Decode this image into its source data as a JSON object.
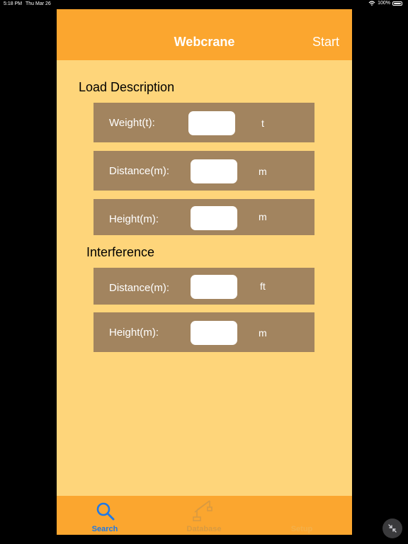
{
  "status_bar": {
    "time": "5:18 PM",
    "date": "Thu Mar 26",
    "battery": "100%"
  },
  "nav": {
    "title": "Webcrane",
    "start_label": "Start"
  },
  "load_description": {
    "title": "Load Description",
    "rows": [
      {
        "label": "Weight(t):",
        "value": "",
        "unit": "t"
      },
      {
        "label": "Distance(m):",
        "value": "",
        "unit": "m"
      },
      {
        "label": "Height(m):",
        "value": "",
        "unit": "m"
      }
    ]
  },
  "interference": {
    "title": "Interference",
    "rows": [
      {
        "label": "Distance(m):",
        "value": "",
        "unit": "ft"
      },
      {
        "label": "Height(m):",
        "value": "",
        "unit": "m"
      }
    ]
  },
  "tabs": [
    {
      "label": "Search",
      "icon": "search-icon",
      "selected": true
    },
    {
      "label": "Database",
      "icon": "crane-icon",
      "selected": false
    },
    {
      "label": "Setup",
      "icon": "",
      "selected": false
    }
  ],
  "colors": {
    "nav_bar": "#fba62f",
    "content_background": "#fed57a",
    "row_background": "#a2845f",
    "tab_selected": "#1f79e6"
  }
}
